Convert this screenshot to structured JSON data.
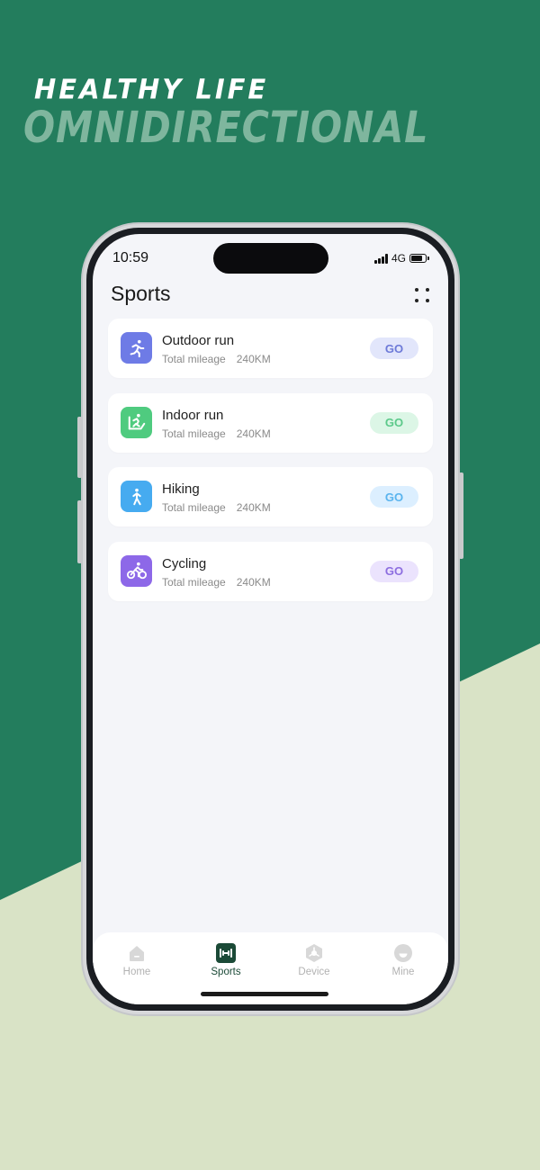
{
  "promo": {
    "line1": "HEALTHY LIFE",
    "line2": "OMNIDIRECTIONAL"
  },
  "status_bar": {
    "time": "10:59",
    "network": "4G",
    "battery_level": 0.8
  },
  "page": {
    "title": "Sports"
  },
  "activities": [
    {
      "name": "Outdoor run",
      "mileage_label": "Total mileage",
      "mileage_value": "240KM",
      "action": "GO",
      "icon": "running-person-icon",
      "icon_color": "#6e7be6",
      "button_bg": "#e2e6fb",
      "button_text": "#6d7ad8"
    },
    {
      "name": "Indoor run",
      "mileage_label": "Total mileage",
      "mileage_value": "240KM",
      "action": "GO",
      "icon": "treadmill-icon",
      "icon_color": "#4fcb7f",
      "button_bg": "#dcf6e6",
      "button_text": "#5cc98a"
    },
    {
      "name": "Hiking",
      "mileage_label": "Total mileage",
      "mileage_value": "240KM",
      "action": "GO",
      "icon": "walking-person-icon",
      "icon_color": "#46abf0",
      "button_bg": "#dcefff",
      "button_text": "#5ab4ee"
    },
    {
      "name": "Cycling",
      "mileage_label": "Total mileage",
      "mileage_value": "240KM",
      "action": "GO",
      "icon": "cyclist-icon",
      "icon_color": "#8d68e8",
      "button_bg": "#ebe3fd",
      "button_text": "#8d6ee0"
    }
  ],
  "tabbar": {
    "items": [
      {
        "label": "Home",
        "icon": "home-icon",
        "active": false
      },
      {
        "label": "Sports",
        "icon": "dumbbell-icon",
        "active": true
      },
      {
        "label": "Device",
        "icon": "device-icon",
        "active": false
      },
      {
        "label": "Mine",
        "icon": "smiley-icon",
        "active": false
      }
    ]
  },
  "colors": {
    "brand_green": "#237d5d",
    "background_light": "#d9e3c6",
    "tab_active": "#1b4a37"
  }
}
